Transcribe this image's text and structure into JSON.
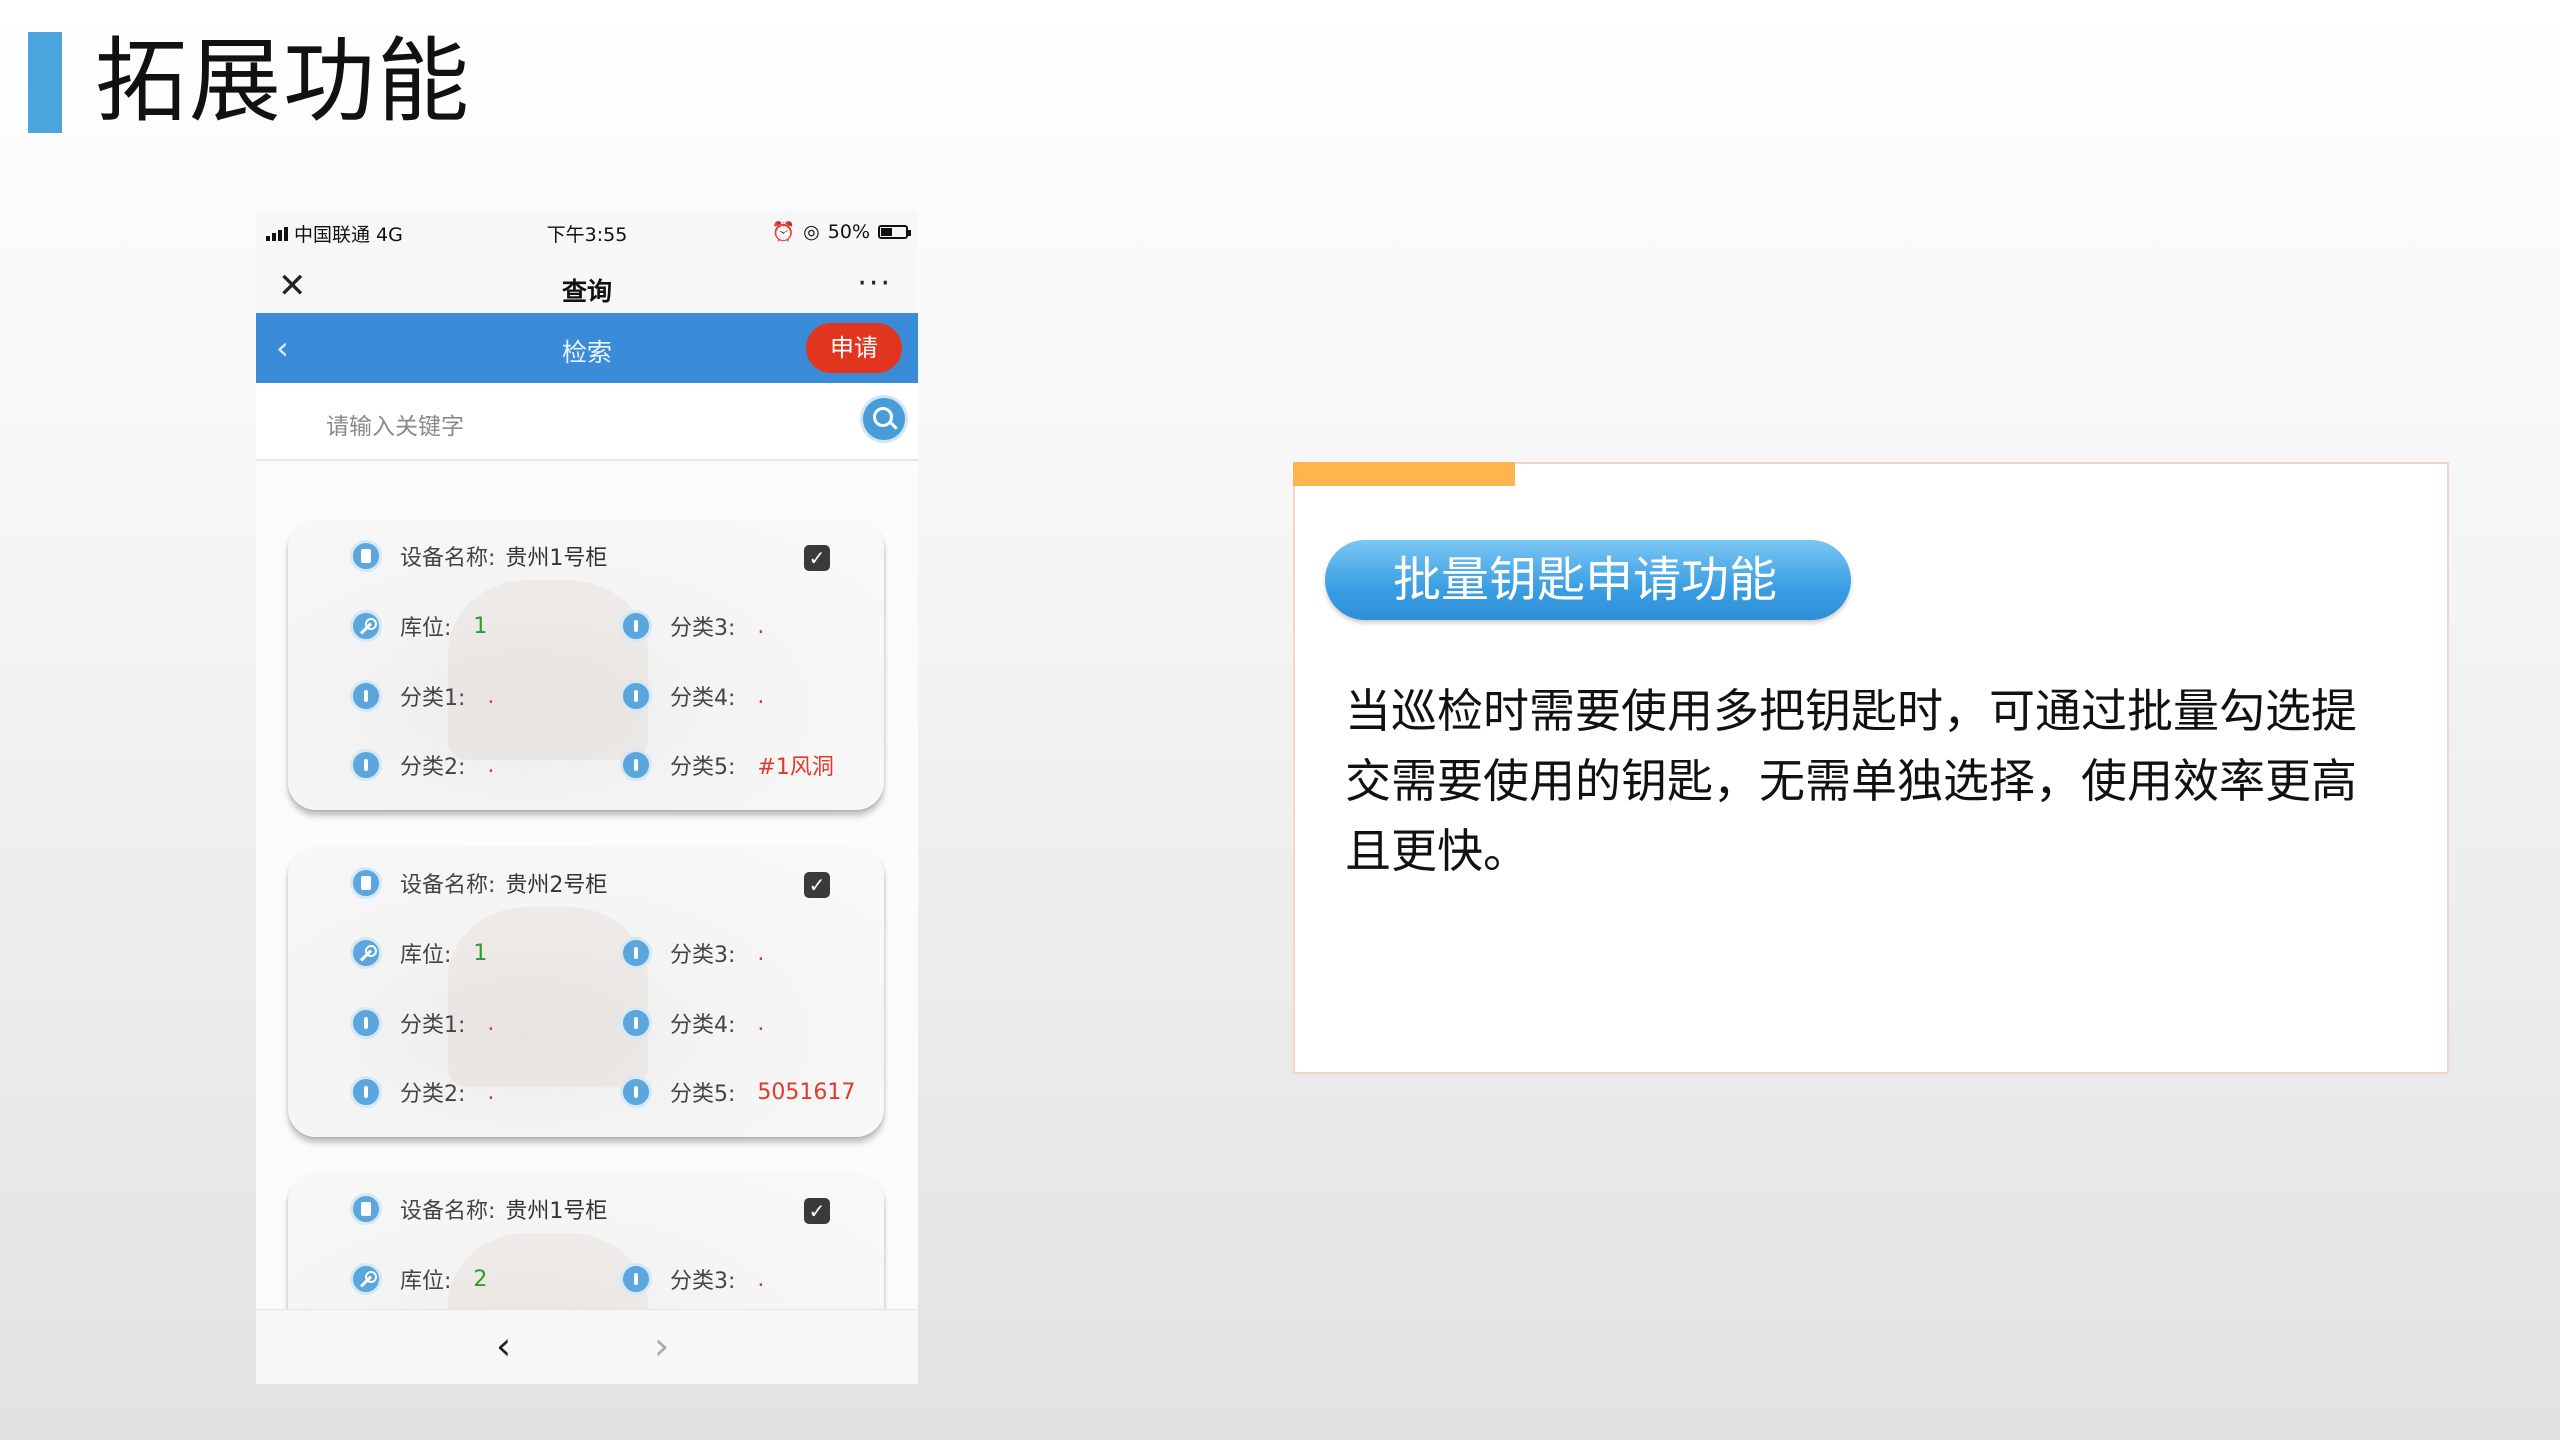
{
  "page": {
    "title": "拓展功能"
  },
  "phone": {
    "status": {
      "carrier": "中国联通 4G",
      "time": "下午3:55",
      "battery": "50%"
    },
    "navbar": {
      "close": "✕",
      "title": "查询",
      "more": "···"
    },
    "bluebar": {
      "back": "‹",
      "title": "检索",
      "apply": "申请"
    },
    "search": {
      "placeholder": "请输入关键字"
    },
    "labels": {
      "device": "设备名称:",
      "location": "库位:",
      "cat1": "分类1:",
      "cat2": "分类2:",
      "cat3": "分类3:",
      "cat4": "分类4:",
      "cat5": "分类5:"
    },
    "cards": [
      {
        "device": "贵州1号柜",
        "location": "1",
        "cat1": ".",
        "cat2": ".",
        "cat3": ".",
        "cat4": ".",
        "cat5": "#1风洞",
        "checked": true
      },
      {
        "device": "贵州2号柜",
        "location": "1",
        "cat1": ".",
        "cat2": ".",
        "cat3": ".",
        "cat4": ".",
        "cat5": "5051617",
        "checked": true
      },
      {
        "device": "贵州1号柜",
        "location": "2",
        "cat3": ".",
        "checked": true
      }
    ],
    "bottom": {
      "prev": "‹",
      "next": "›"
    }
  },
  "panel": {
    "heading": "批量钥匙申请功能",
    "description": "当巡检时需要使用多把钥匙时，可通过批量勾选提交需要使用的钥匙，无需单独选择，使用效率更高且更快。",
    "accent_color": "#ffb44e",
    "pill_color": "#3a9ee3"
  }
}
